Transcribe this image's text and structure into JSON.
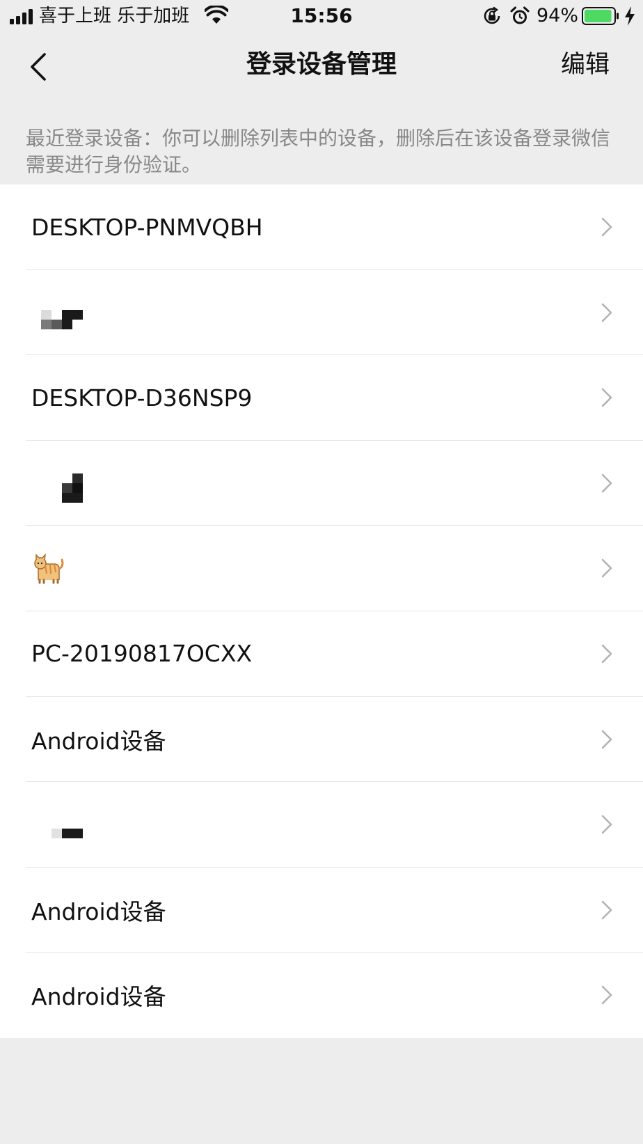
{
  "status_bar": {
    "carrier": "喜于上班 乐于加班",
    "time": "15:56",
    "battery_percent": "94%",
    "battery_level": 0.94,
    "icons": [
      "signal-icon",
      "wifi-icon",
      "orientation-lock-icon",
      "alarm-icon",
      "battery-icon",
      "charging-bolt-icon"
    ]
  },
  "nav": {
    "back_icon": "chevron-left-icon",
    "title": "登录设备管理",
    "edit_label": "编辑"
  },
  "hint": "最近登录设备：你可以删除列表中的设备，删除后在该设备登录微信需要进行身份验证。",
  "devices": [
    {
      "name": "DESKTOP-PNMVQBH"
    },
    {
      "name": "",
      "icon": "pixelated-name"
    },
    {
      "name": "DESKTOP-D36NSP9"
    },
    {
      "name": "",
      "icon": "pixelated-name"
    },
    {
      "name": "",
      "icon": "cat-icon"
    },
    {
      "name": "PC-20190817OCXX"
    },
    {
      "name": "Android设备"
    },
    {
      "name": "",
      "icon": "pixelated-name"
    },
    {
      "name": "Android设备"
    },
    {
      "name": "Android设备"
    }
  ],
  "colors": {
    "background": "#ededed",
    "card": "#ffffff",
    "hint_text": "#888888",
    "chevron": "#b2b2b2",
    "battery_green": "#4cd964"
  }
}
